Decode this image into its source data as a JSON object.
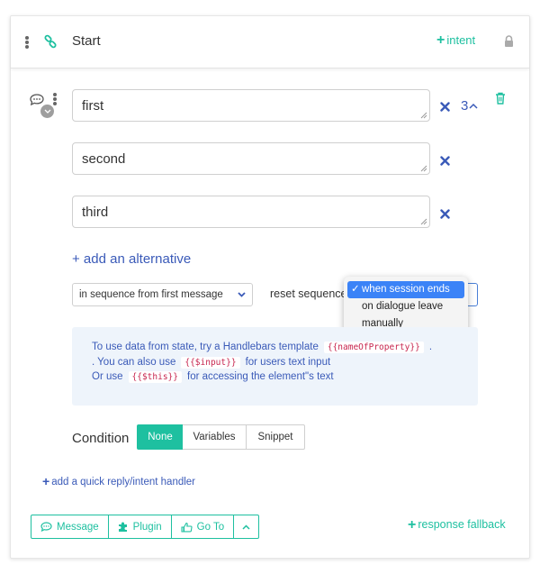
{
  "header": {
    "title": "Start",
    "intent_label": "intent"
  },
  "alternatives": [
    {
      "value": "first"
    },
    {
      "value": "second"
    },
    {
      "value": "third"
    }
  ],
  "count": "3",
  "add_alternative": "+ add an alternative",
  "sequence_select": {
    "value": "in sequence from first message"
  },
  "reset": {
    "label": "reset sequence",
    "options": [
      "when session ends",
      "on dialogue leave",
      "manually"
    ],
    "selected": "when session ends"
  },
  "info": {
    "line1_text": "To use data from state, try a Handlebars template",
    "line1_code": "{{nameOfProperty}}",
    "line1_end": ".",
    "line2_text": ". You can also use",
    "line2_code": "{{$input}}",
    "line2_end": "for users text input",
    "line3_text": "Or use",
    "line3_code": "{{$this}}",
    "line3_end": "for accessing the element\"s text"
  },
  "condition": {
    "label": "Condition",
    "options": [
      "None",
      "Variables",
      "Snippet"
    ],
    "active": "None"
  },
  "quick_reply": "add a quick reply/intent handler",
  "footer": {
    "message": "Message",
    "plugin": "Plugin",
    "goto": "Go To"
  },
  "fallback": "response fallback",
  "colors": {
    "accent": "#1ec0a0",
    "link": "#3a5ab8",
    "highlight": "#3b83f7"
  }
}
